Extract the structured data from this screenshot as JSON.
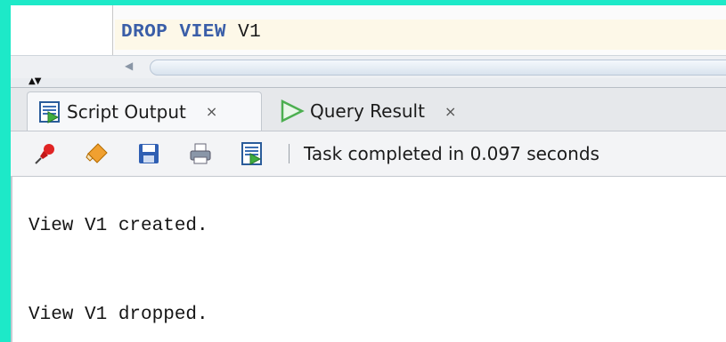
{
  "editor": {
    "code": {
      "keyword1": "DROP",
      "keyword2": "VIEW",
      "identifier": "V1"
    }
  },
  "tabs": [
    {
      "label": "Script Output",
      "close": "×",
      "active": true,
      "icon": "script-output-icon"
    },
    {
      "label": "Query Result",
      "close": "×",
      "active": false,
      "icon": "play-triangle-icon"
    }
  ],
  "toolbar": {
    "icons": [
      "pin-icon",
      "eraser-icon",
      "save-icon",
      "print-icon",
      "script-icon"
    ],
    "status": "Task completed in 0.097 seconds"
  },
  "output": {
    "lines": [
      "View V1 created.",
      "View V1 dropped."
    ]
  },
  "colors": {
    "background": "#1de9c8",
    "keyword": "#3a5ea8",
    "current_line": "#fdf8e8",
    "play_green": "#4caf50"
  }
}
